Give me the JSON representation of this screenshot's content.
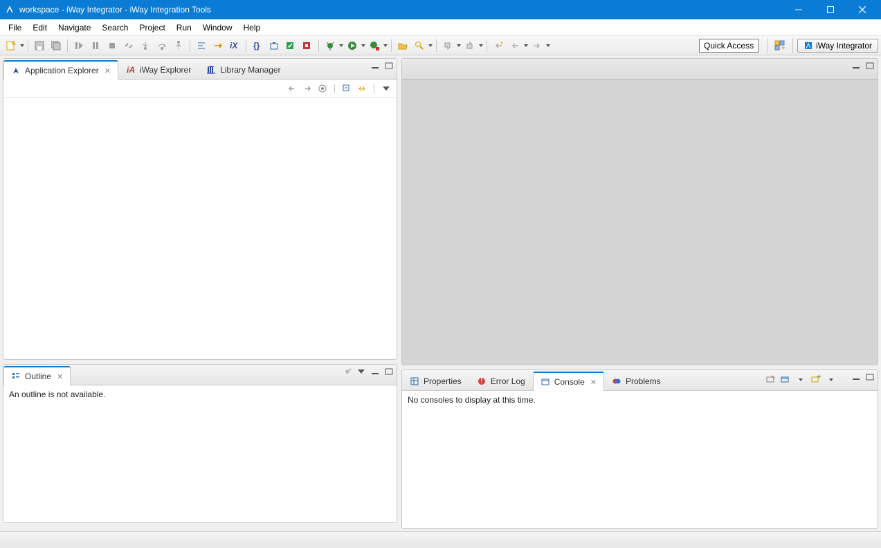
{
  "window": {
    "title": "workspace - iWay Integrator - iWay Integration Tools"
  },
  "menu": {
    "items": [
      "File",
      "Edit",
      "Navigate",
      "Search",
      "Project",
      "Run",
      "Window",
      "Help"
    ]
  },
  "toolbar": {
    "quick_access": "Quick Access",
    "perspective": "iWay Integrator"
  },
  "views": {
    "explorer": {
      "tabs": [
        "Application Explorer",
        "iWay Explorer",
        "Library Manager"
      ],
      "active": 0
    },
    "outline": {
      "label": "Outline",
      "body": "An outline is not available."
    },
    "bottom_right": {
      "tabs": [
        "Properties",
        "Error Log",
        "Console",
        "Problems"
      ],
      "active": 2,
      "console_body": "No consoles to display at this time."
    }
  }
}
